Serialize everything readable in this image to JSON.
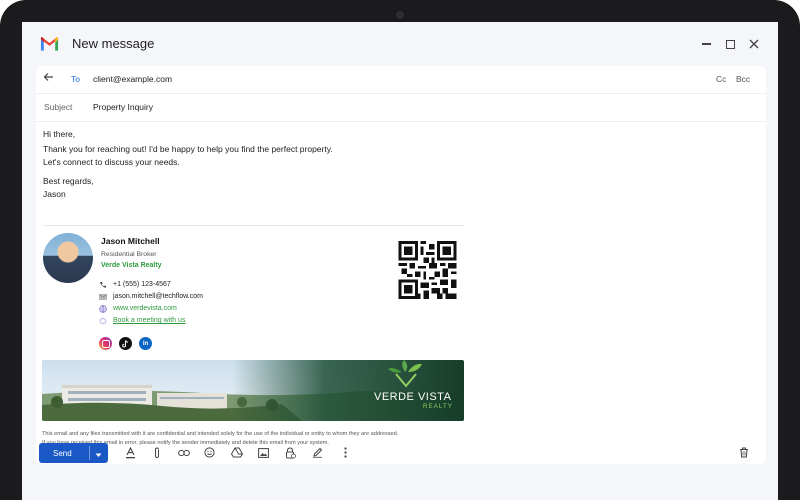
{
  "window": {
    "title": "New message"
  },
  "to": {
    "label": "To",
    "value": "client@example.com",
    "cc": "Cc",
    "bcc": "Bcc"
  },
  "subject": {
    "label": "Subject",
    "value": "Property Inquiry"
  },
  "body": {
    "greeting": "Hi there,",
    "line1": "Thank you for reaching out! I'd be happy to help you find the perfect property.",
    "line2": "Let's connect to discuss your needs.",
    "closing": "Best regards,",
    "signoff": "Jason"
  },
  "signature": {
    "name": "Jason Mitchell",
    "role": "Residential Broker",
    "company": "Verde Vista Realty",
    "phone": "+1 (555) 123-4567",
    "email": "jason.mitchell@techflow.com",
    "website": "www.verdevista.com",
    "booking": "Book a meeting with us",
    "brand_color": "#2e9a3e",
    "banner_title": "VERDE VISTA",
    "banner_subtitle": "REALTY"
  },
  "disclaimer": {
    "line1": "This email and any files transmitted with it are confidential and intended solely for the use of the individual or entity to whom they are addressed.",
    "line2": "If you have received this email in error, please notify the sender immediately and delete this email from your system."
  },
  "toolbar": {
    "send": "Send"
  },
  "colors": {
    "accent": "#1a59c5",
    "link": "#2e9a3e"
  }
}
